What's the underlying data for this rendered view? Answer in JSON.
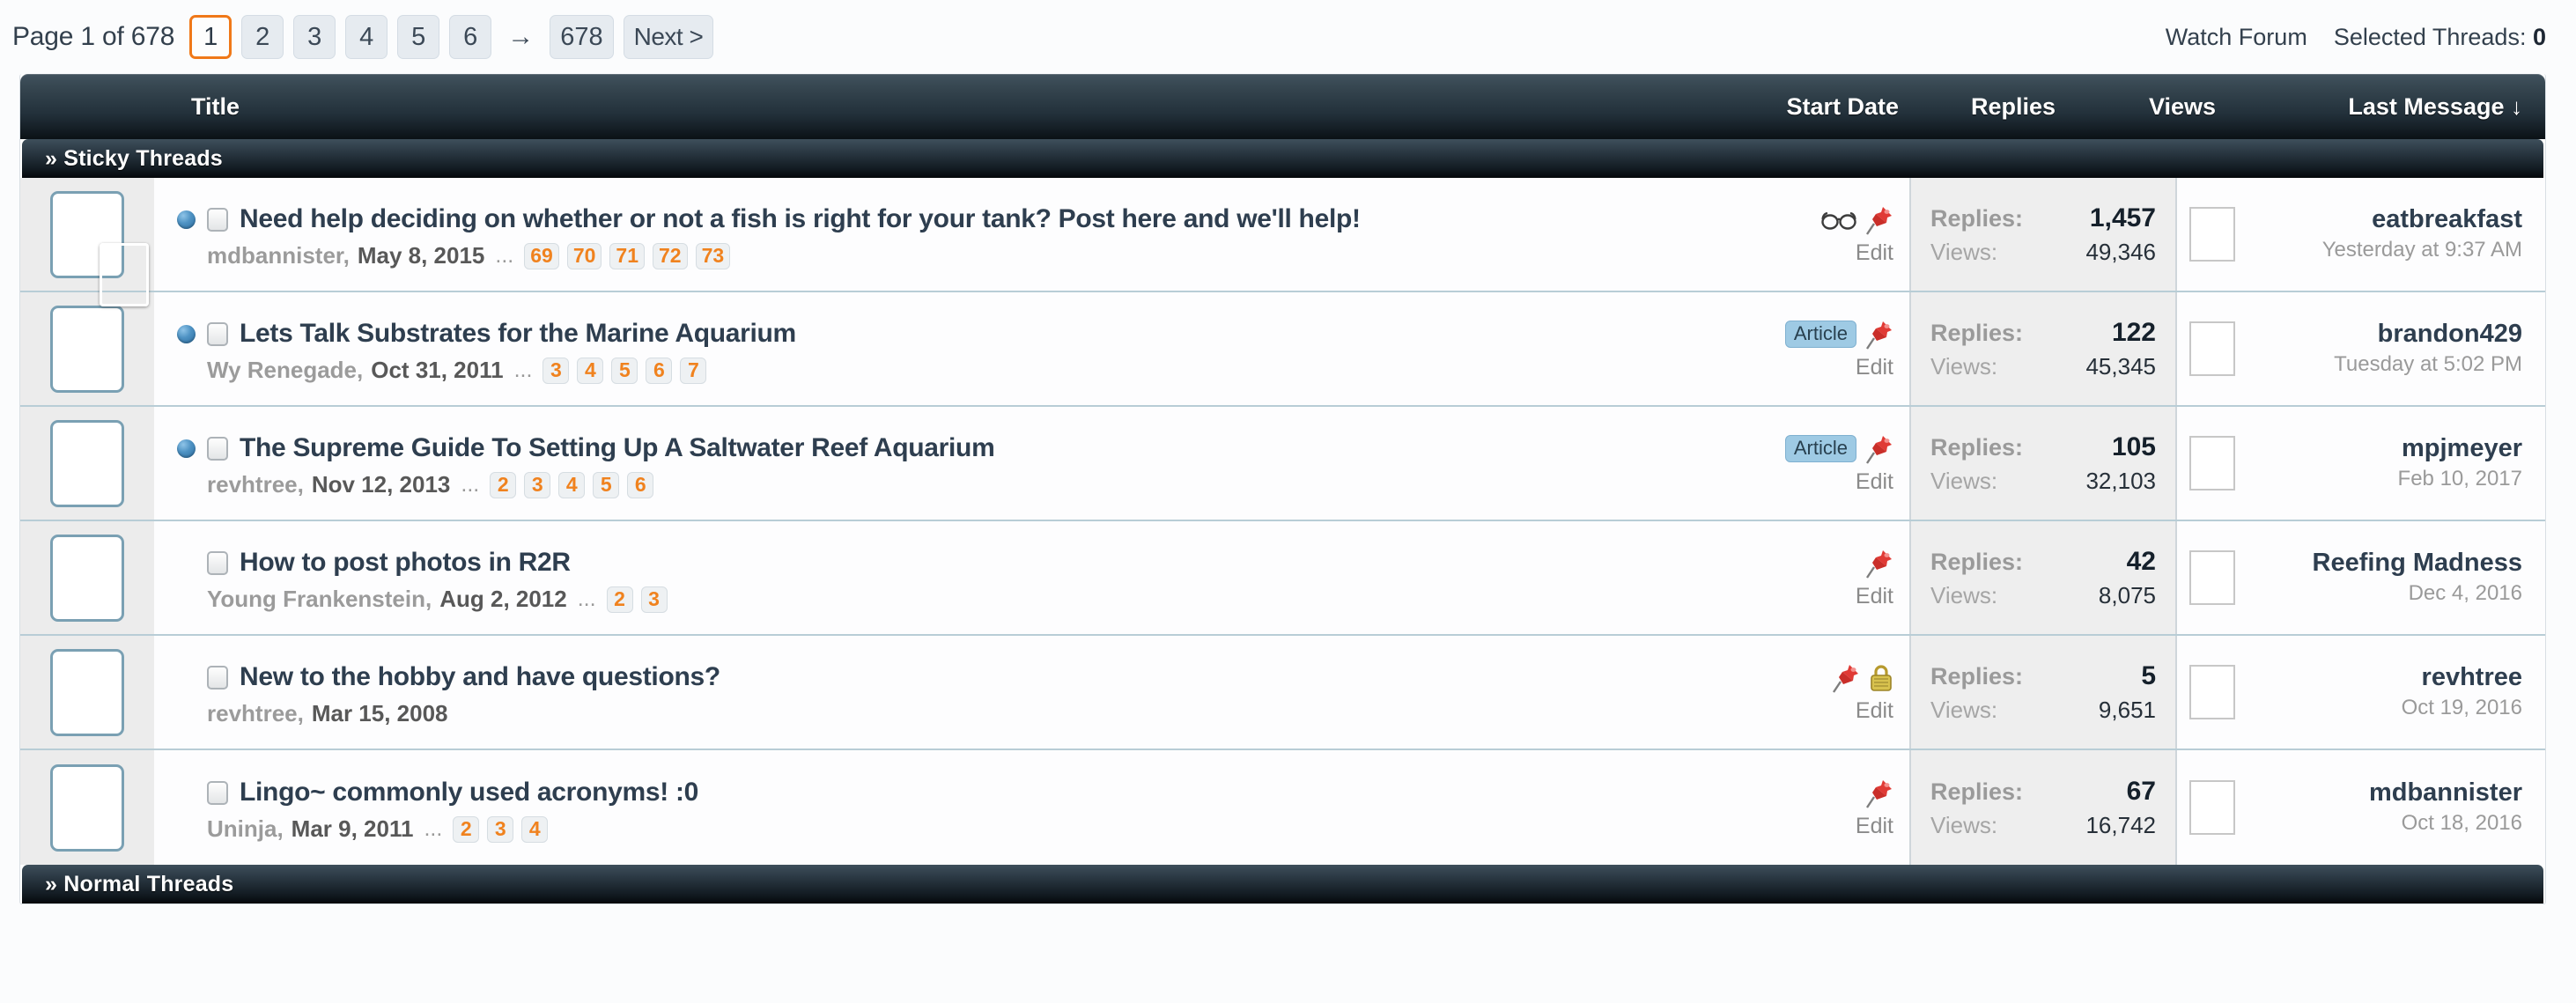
{
  "pagination": {
    "page_of_label": "Page 1 of 678",
    "pages": [
      "1",
      "2",
      "3",
      "4",
      "5",
      "6"
    ],
    "current_page": "1",
    "arrow": "→",
    "last_page": "678",
    "next_label": "Next >"
  },
  "topright": {
    "watch_forum": "Watch Forum",
    "selected_threads_label": "Selected Threads:",
    "selected_threads_count": "0"
  },
  "columns": {
    "title": "Title",
    "start_date": "Start Date",
    "replies": "Replies",
    "views": "Views",
    "last_message": "Last Message",
    "sort_arrow": "↓"
  },
  "sections": {
    "sticky": "» Sticky Threads",
    "normal": "» Normal Threads"
  },
  "labels": {
    "replies": "Replies:",
    "views": "Views:",
    "edit": "Edit",
    "article": "Article",
    "ellipsis": "..."
  },
  "threads": [
    {
      "title": "Need help deciding on whether or not a fish is right for your tank? Post here and we'll help!",
      "author": "mdbannister,",
      "date": "May 8, 2015",
      "pages": [
        "69",
        "70",
        "71",
        "72",
        "73"
      ],
      "unread": true,
      "article": false,
      "watched": true,
      "pinned": true,
      "locked": false,
      "replies": "1,457",
      "views": "49,346",
      "last_user": "eatbreakfast",
      "last_date": "Yesterday at 9:37 AM",
      "avatar_class": "ph1",
      "sub_avatar_class": "ph1b",
      "last_avatar_class": "ph2"
    },
    {
      "title": "Lets Talk Substrates for the Marine Aquarium",
      "author": "Wy Renegade,",
      "date": "Oct 31, 2011",
      "pages": [
        "3",
        "4",
        "5",
        "6",
        "7"
      ],
      "unread": true,
      "article": true,
      "watched": false,
      "pinned": true,
      "locked": false,
      "replies": "122",
      "views": "45,345",
      "last_user": "brandon429",
      "last_date": "Tuesday at 5:02 PM",
      "avatar_class": "ph2",
      "sub_avatar_class": null,
      "last_avatar_class": "ph7"
    },
    {
      "title": "The Supreme Guide To Setting Up A Saltwater Reef Aquarium",
      "author": "revhtree,",
      "date": "Nov 12, 2013",
      "pages": [
        "2",
        "3",
        "4",
        "5",
        "6"
      ],
      "unread": true,
      "article": true,
      "watched": false,
      "pinned": true,
      "locked": false,
      "replies": "105",
      "views": "32,103",
      "last_user": "mpjmeyer",
      "last_date": "Feb 10, 2017",
      "avatar_class": "ph3",
      "sub_avatar_class": null,
      "last_avatar_class": "ph3"
    },
    {
      "title": "How to post photos in R2R",
      "author": "Young Frankenstein,",
      "date": "Aug 2, 2012",
      "pages": [
        "2",
        "3"
      ],
      "unread": false,
      "article": false,
      "watched": false,
      "pinned": true,
      "locked": false,
      "replies": "42",
      "views": "8,075",
      "last_user": "Reefing Madness",
      "last_date": "Dec 4, 2016",
      "avatar_class": "ph4",
      "sub_avatar_class": null,
      "last_avatar_class": "ph8"
    },
    {
      "title": "New to the hobby and have questions?",
      "author": "revhtree,",
      "date": "Mar 15, 2008",
      "pages": [],
      "unread": false,
      "article": false,
      "watched": false,
      "pinned": true,
      "locked": true,
      "replies": "5",
      "views": "9,651",
      "last_user": "revhtree",
      "last_date": "Oct 19, 2016",
      "avatar_class": "ph3",
      "sub_avatar_class": null,
      "last_avatar_class": "ph3"
    },
    {
      "title": "Lingo~ commonly used acronyms! :0",
      "author": "Uninja,",
      "date": "Mar 9, 2011",
      "pages": [
        "2",
        "3",
        "4"
      ],
      "unread": false,
      "article": false,
      "watched": false,
      "pinned": true,
      "locked": false,
      "replies": "67",
      "views": "16,742",
      "last_user": "mdbannister",
      "last_date": "Oct 18, 2016",
      "avatar_class": "ph5",
      "sub_avatar_class": null,
      "last_avatar_class": "ph1"
    }
  ]
}
